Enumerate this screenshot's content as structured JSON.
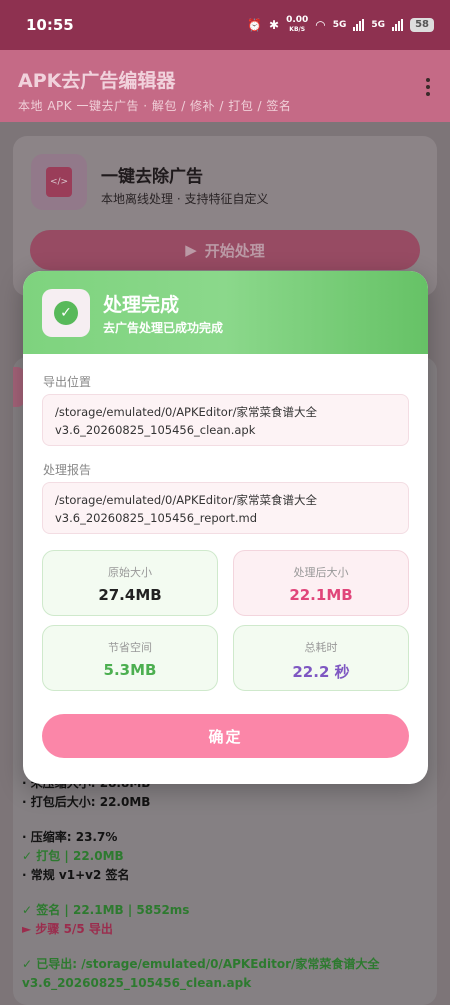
{
  "status": {
    "time": "10:55",
    "speed_value": "0.00",
    "speed_unit": "KB/S",
    "signal1": "5G",
    "signal2": "5G",
    "battery": "58"
  },
  "app": {
    "title": "APK去广告编辑器",
    "subtitle": "本地 APK 一键去广告 · 解包 / 修补 / 打包 / 签名"
  },
  "main_card": {
    "icon": "apk-file-icon",
    "icon_text": "</>",
    "heading": "一键去除广告",
    "description": "本地离线处理 · 支持特征自定义",
    "start_icon": "▶",
    "start_label": "开始处理"
  },
  "dialog": {
    "title": "处理完成",
    "subtitle": "去广告处理已成功完成",
    "export_label": "导出位置",
    "export_path": "/storage/emulated/0/APKEditor/家常菜食谱大全 v3.6_20260825_105456_clean.apk",
    "report_label": "处理报告",
    "report_path": "/storage/emulated/0/APKEditor/家常菜食谱大全 v3.6_20260825_105456_report.md",
    "stats": [
      {
        "label": "原始大小",
        "value": "27.4MB",
        "color": "#222222"
      },
      {
        "label": "处理后大小",
        "value": "22.1MB",
        "color": "#e0457a"
      },
      {
        "label": "节省空间",
        "value": "5.3MB",
        "color": "#4caf50"
      },
      {
        "label": "总耗时",
        "value": "22.2 秒",
        "color": "#7e57c2"
      }
    ],
    "confirm_label": "确定"
  },
  "log": {
    "line1": "· 未压缩大小: 28.8MB",
    "line2": "· 打包后大小: 22.0MB",
    "line3": "· 压缩率: 23.7%",
    "line4": "✓ 打包 | 22.0MB",
    "line5": "· 常规 v1+v2 签名",
    "line6": "✓ 签名 | 22.1MB | 5852ms",
    "line7": "► 步骤 5/5 导出",
    "line8": "✓ 已导出: /storage/emulated/0/APKEditor/家常菜食谱大全",
    "line9": "v3.6_20260825_105456_clean.apk"
  }
}
